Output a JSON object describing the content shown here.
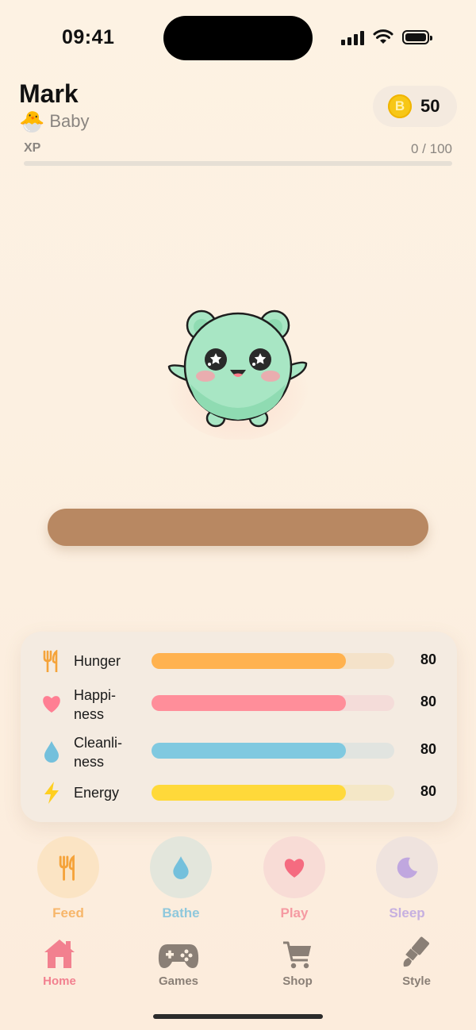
{
  "status_bar": {
    "time": "09:41"
  },
  "header": {
    "pet_name": "Mark",
    "stage_icon": "🐣",
    "stage_label": "Baby",
    "coins": "50",
    "coin_icon": "coin-icon",
    "coin_symbol": "B",
    "xp_label": "XP",
    "xp_value": "0 / 100",
    "xp_progress": 0
  },
  "stats": [
    {
      "label": "Hunger",
      "value": "80",
      "fraction": 0.8,
      "icon": "fork-knife-icon",
      "color": "#ffb24f",
      "track": "#f4e2c9"
    },
    {
      "label": "Happi-\nness",
      "value": "80",
      "fraction": 0.8,
      "icon": "heart-icon",
      "color": "#ff8e9a",
      "track": "#f4dcd9"
    },
    {
      "label": "Cleanli-\nness",
      "value": "80",
      "fraction": 0.8,
      "icon": "droplet-icon",
      "color": "#80c9e0",
      "track": "#e1e4e0"
    },
    {
      "label": "Energy",
      "value": "80",
      "fraction": 0.8,
      "icon": "bolt-icon",
      "color": "#ffd93a",
      "track": "#f4e7c6"
    }
  ],
  "actions": [
    {
      "label": "Feed",
      "icon": "fork-knife-icon",
      "color": "#f7b66a"
    },
    {
      "label": "Bathe",
      "icon": "droplet-icon",
      "color": "#8fc8dc"
    },
    {
      "label": "Play",
      "icon": "heart-icon",
      "color": "#f59aa2"
    },
    {
      "label": "Sleep",
      "icon": "moon-icon",
      "color": "#c6b0e0"
    }
  ],
  "tabs": [
    {
      "label": "Home",
      "icon": "house-icon",
      "active": true
    },
    {
      "label": "Games",
      "icon": "gamepad-icon",
      "active": false
    },
    {
      "label": "Shop",
      "icon": "cart-icon",
      "active": false
    },
    {
      "label": "Style",
      "icon": "brush-icon",
      "active": false
    }
  ],
  "colors": {
    "accent": "#f2808f",
    "platform": "#b88862",
    "pet_body": "#a8e6c4"
  }
}
